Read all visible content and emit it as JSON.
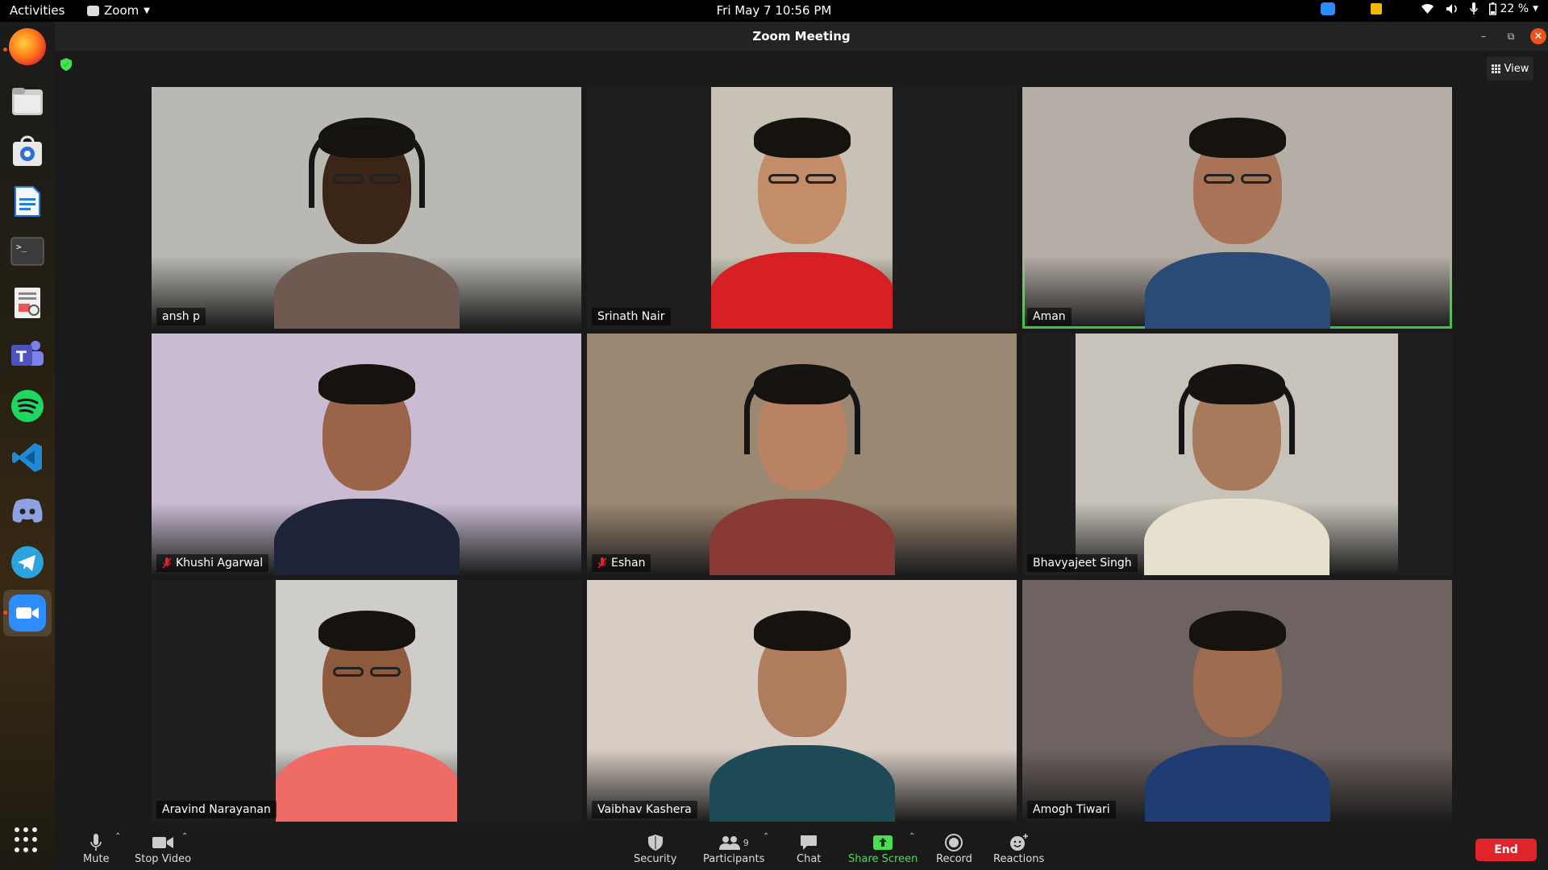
{
  "topbar": {
    "activities": "Activities",
    "app_name": "Zoom",
    "clock": "Fri May 7  10:56 PM",
    "battery": "22 %"
  },
  "window": {
    "title": "Zoom Meeting",
    "view_label": "View"
  },
  "participants": [
    {
      "name": "ansh p",
      "muted": false,
      "active_speaker": false,
      "bg": "#b9b8b2",
      "skin": "#3b2517",
      "shirt": "#6e5a50",
      "headphones": true,
      "glasses": true
    },
    {
      "name": "Srinath Nair",
      "muted": false,
      "active_speaker": false,
      "bg": "#c8c2b6",
      "skin": "#c48d6a",
      "shirt": "#d62024",
      "headphones": false,
      "glasses": true
    },
    {
      "name": "Aman",
      "muted": false,
      "active_speaker": true,
      "bg": "#b5aea6",
      "skin": "#a97358",
      "shirt": "#2a4a78",
      "headphones": false,
      "glasses": true
    },
    {
      "name": "Khushi Agarwal",
      "muted": true,
      "active_speaker": false,
      "bg": "#c9bcd2",
      "skin": "#9a6448",
      "shirt": "#1e2438",
      "headphones": false,
      "glasses": false
    },
    {
      "name": "Eshan",
      "muted": true,
      "active_speaker": false,
      "bg": "#9b8873",
      "skin": "#b88263",
      "shirt": "#8a3a34",
      "headphones": true,
      "glasses": false
    },
    {
      "name": "Bhavyajeet Singh",
      "muted": false,
      "active_speaker": false,
      "bg": "#c7c3bb",
      "skin": "#a87a5c",
      "shirt": "#e6e1cf",
      "headphones": true,
      "glasses": false
    },
    {
      "name": "Aravind Narayanan",
      "muted": false,
      "active_speaker": false,
      "bg": "#cfcdc9",
      "skin": "#8e5a3e",
      "shirt": "#ef6b66",
      "headphones": false,
      "glasses": true
    },
    {
      "name": "Vaibhav Kashera",
      "muted": false,
      "active_speaker": false,
      "bg": "#d8cdc4",
      "skin": "#b07c5e",
      "shirt": "#1e4a56",
      "headphones": false,
      "glasses": false
    },
    {
      "name": "Amogh Tiwari",
      "muted": false,
      "active_speaker": false,
      "bg": "#6e6360",
      "skin": "#a06c50",
      "shirt": "#1f3d72",
      "headphones": false,
      "glasses": false
    }
  ],
  "toolbar": {
    "mute": "Mute",
    "stop_video": "Stop Video",
    "security": "Security",
    "participants": "Participants",
    "participants_count": "9",
    "chat": "Chat",
    "share_screen": "Share Screen",
    "record": "Record",
    "reactions": "Reactions",
    "end": "End"
  },
  "dock_apps": [
    "firefox-icon",
    "files-icon",
    "software-icon",
    "writer-icon",
    "terminal-icon",
    "document-viewer-icon",
    "teams-icon",
    "spotify-icon",
    "vscode-icon",
    "discord-icon",
    "telegram-icon",
    "zoom-icon"
  ]
}
